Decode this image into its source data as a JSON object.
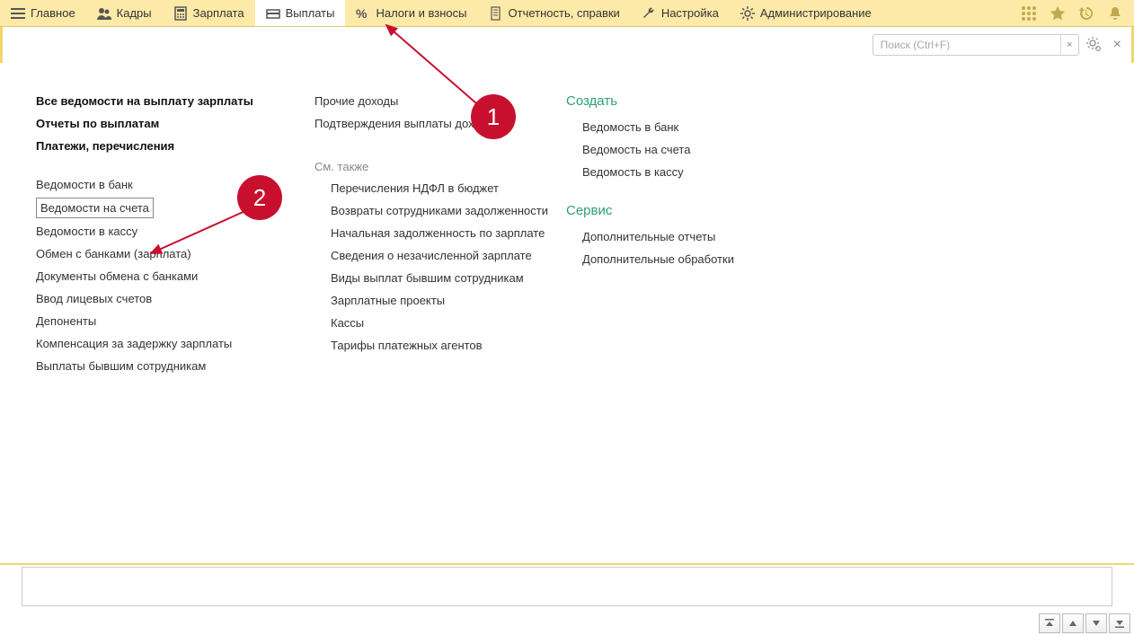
{
  "topMenu": {
    "items": [
      {
        "label": "Главное"
      },
      {
        "label": "Кадры"
      },
      {
        "label": "Зарплата"
      },
      {
        "label": "Выплаты"
      },
      {
        "label": "Налоги и взносы"
      },
      {
        "label": "Отчетность, справки"
      },
      {
        "label": "Настройка"
      },
      {
        "label": "Администрирование"
      }
    ]
  },
  "search": {
    "placeholder": "Поиск (Ctrl+F)"
  },
  "col1": {
    "bold": [
      "Все ведомости на выплату зарплаты",
      "Отчеты по выплатам",
      "Платежи, перечисления"
    ],
    "links": [
      "Ведомости в банк",
      "Ведомости на счета",
      "Ведомости в кассу",
      "Обмен с банками (зарплата)",
      "Документы обмена с банками",
      "Ввод лицевых счетов",
      "Депоненты",
      "Компенсация за задержку зарплаты",
      "Выплаты бывшим сотрудникам"
    ]
  },
  "col2": {
    "top": [
      "Прочие доходы",
      "Подтверждения выплаты дох"
    ],
    "seeAlsoTitle": "См. также",
    "seeAlso": [
      "Перечисления НДФЛ в бюджет",
      "Возвраты сотрудниками задолженности",
      "Начальная задолженность по зарплате",
      "Сведения о незачисленной зарплате",
      "Виды выплат бывшим сотрудникам",
      "Зарплатные проекты",
      "Кассы",
      "Тарифы платежных агентов"
    ]
  },
  "col3": {
    "createTitle": "Создать",
    "create": [
      "Ведомость в банк",
      "Ведомость на счета",
      "Ведомость в кассу"
    ],
    "serviceTitle": "Сервис",
    "service": [
      "Дополнительные отчеты",
      "Дополнительные обработки"
    ]
  },
  "callouts": {
    "c1": "1",
    "c2": "2"
  }
}
